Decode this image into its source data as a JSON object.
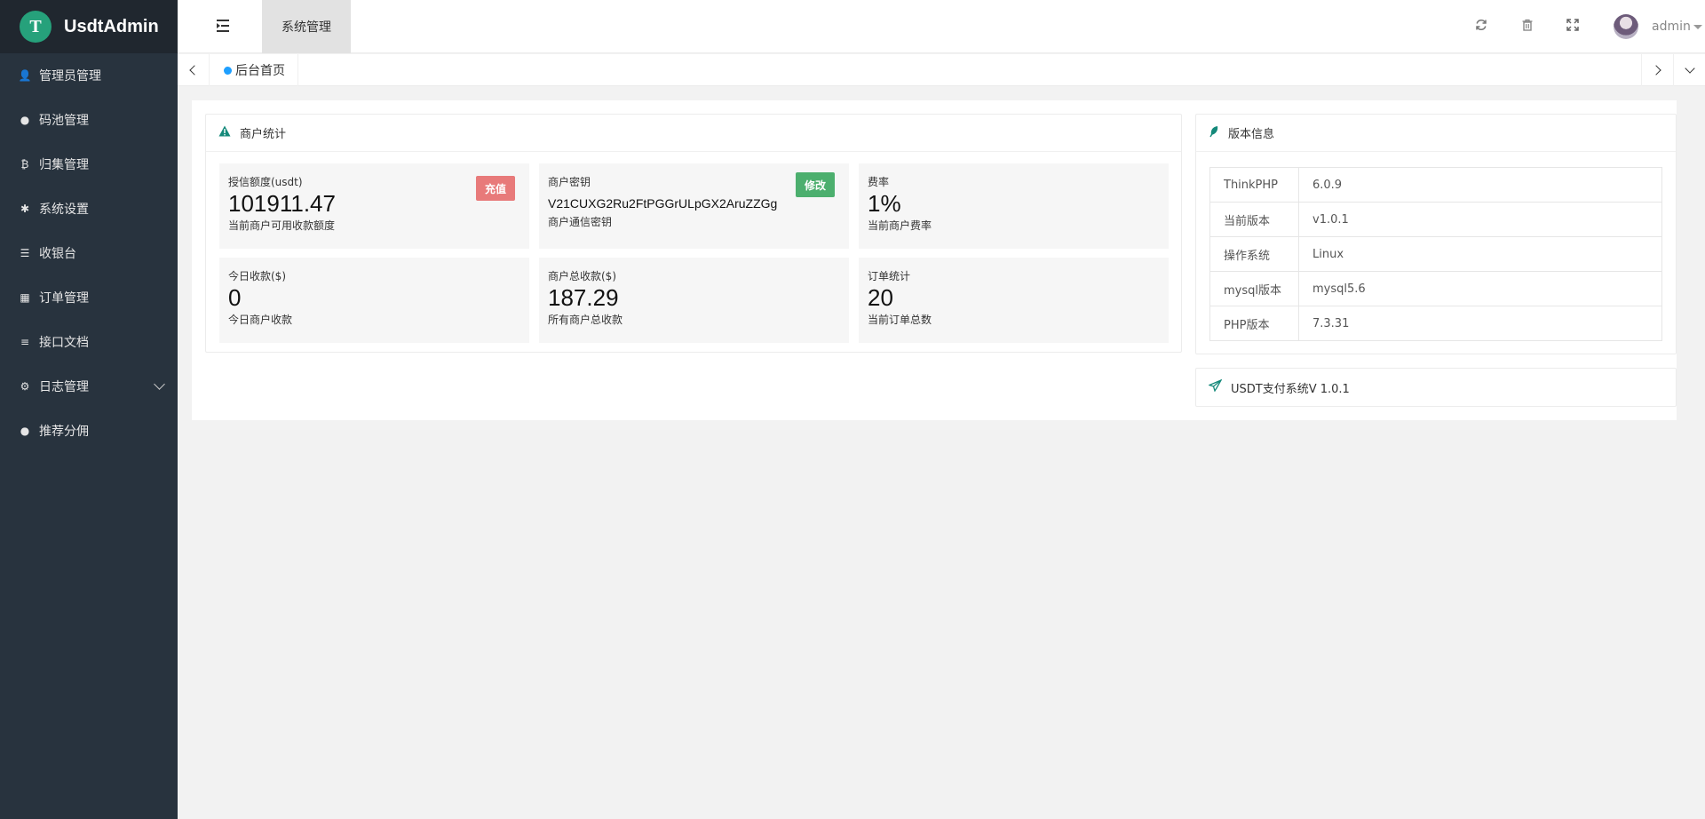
{
  "app": {
    "name": "UsdtAdmin",
    "logo_letter": "T"
  },
  "sidebar": {
    "items": [
      {
        "label": "管理员管理",
        "icon": "user-icon",
        "glyph": "👤"
      },
      {
        "label": "码池管理",
        "icon": "android-icon",
        "glyph": "●"
      },
      {
        "label": "归集管理",
        "icon": "bitcoin-icon",
        "glyph": "₿"
      },
      {
        "label": "系统设置",
        "icon": "asterisk-icon",
        "glyph": "✱"
      },
      {
        "label": "收银台",
        "icon": "list-icon",
        "glyph": "☰"
      },
      {
        "label": "订单管理",
        "icon": "calculator-icon",
        "glyph": "▦"
      },
      {
        "label": "接口文档",
        "icon": "align-left-icon",
        "glyph": "≡"
      },
      {
        "label": "日志管理",
        "icon": "gear-icon",
        "glyph": "⚙"
      },
      {
        "label": "推荐分佣",
        "icon": "android-icon",
        "glyph": "●"
      }
    ]
  },
  "header": {
    "tab_label": "系统管理",
    "user": "admin"
  },
  "tabs": {
    "home": "后台首页"
  },
  "merchant": {
    "title": "商户统计",
    "credit": {
      "label": "授信额度(usdt)",
      "value": "101911.47",
      "desc": "当前商户可用收款额度",
      "button": "充值"
    },
    "secret": {
      "label": "商户密钥",
      "value": "V21CUXG2Ru2FtPGGrULpGX2AruZZGg",
      "desc": "商户通信密钥",
      "button": "修改"
    },
    "rate": {
      "label": "费率",
      "value": "1%",
      "desc": "当前商户费率"
    },
    "today": {
      "label": "今日收款($)",
      "value": "0",
      "desc": "今日商户收款"
    },
    "total": {
      "label": "商户总收款($)",
      "value": "187.29",
      "desc": "所有商户总收款"
    },
    "orders": {
      "label": "订单统计",
      "value": "20",
      "desc": "当前订单总数"
    }
  },
  "version": {
    "title": "版本信息",
    "rows": [
      {
        "key": "ThinkPHP",
        "value": "6.0.9"
      },
      {
        "key": "当前版本",
        "value": "v1.0.1"
      },
      {
        "key": "操作系统",
        "value": "Linux"
      },
      {
        "key": "mysql版本",
        "value": "mysql5.6"
      },
      {
        "key": "PHP版本",
        "value": "7.3.31"
      }
    ]
  },
  "system": {
    "title": "USDT支付系统V 1.0.1"
  },
  "colors": {
    "sidebar": "#28333e",
    "logo_bg": "#20272f",
    "accent": "#1e9fff",
    "tether": "#26a17b",
    "btn_red": "#e87a7a",
    "btn_green": "#4caf6e"
  }
}
